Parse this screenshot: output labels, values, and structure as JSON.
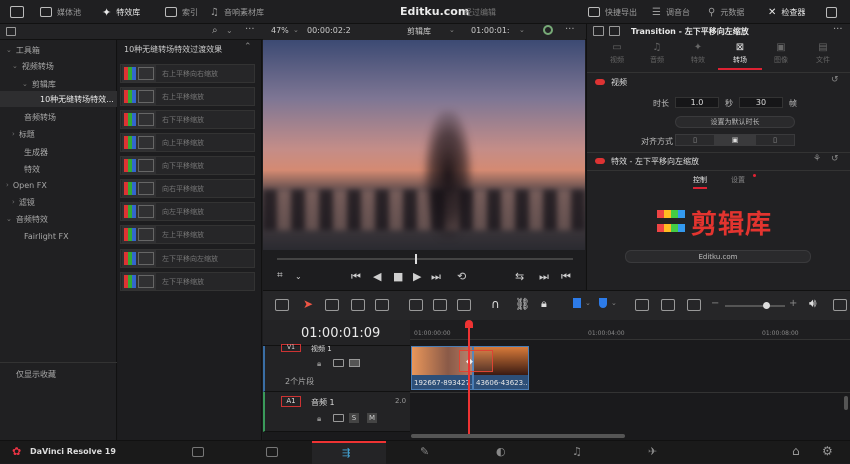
{
  "topbar": {
    "tabs": [
      {
        "label": "媒体池",
        "icon": "media-pool-icon"
      },
      {
        "label": "特效库",
        "icon": "effects-library-icon",
        "active": true
      },
      {
        "label": "索引",
        "icon": "index-icon"
      },
      {
        "label": "音响素材库",
        "icon": "sound-library-icon"
      }
    ],
    "title": "Editku.com",
    "subtitle": "经过编辑",
    "right_tabs": [
      {
        "label": "快捷导出",
        "icon": "quick-export-icon"
      },
      {
        "label": "调音台",
        "icon": "mixer-icon"
      },
      {
        "label": "元数据",
        "icon": "metadata-icon"
      },
      {
        "label": "检查器",
        "icon": "inspector-icon",
        "active": true
      }
    ]
  },
  "viewer": {
    "zoom": "47%",
    "timecode": "00:00:02:2",
    "clip_name": "剪辑库",
    "current_timecode": "01:00:01:"
  },
  "sidebar": {
    "items": [
      {
        "label": "工具箱",
        "depth": 0,
        "expanded": true
      },
      {
        "label": "视频转场",
        "depth": 1,
        "expanded": true
      },
      {
        "label": "剪辑库",
        "depth": 2,
        "expanded": true
      },
      {
        "label": "10种无缝转场特效...",
        "depth": 3,
        "selected": true
      },
      {
        "label": "音频转场",
        "depth": 1
      },
      {
        "label": "标题",
        "depth": 1,
        "collapsed": true
      },
      {
        "label": "生成器",
        "depth": 1
      },
      {
        "label": "特效",
        "depth": 1
      },
      {
        "label": "Open FX",
        "depth": 0,
        "collapsed": true
      },
      {
        "label": "滤镜",
        "depth": 1,
        "collapsed": true
      },
      {
        "label": "音频特效",
        "depth": 0,
        "expanded": true
      },
      {
        "label": "Fairlight FX",
        "depth": 1
      }
    ],
    "favorites_label": "仅显示收藏"
  },
  "fxlist": {
    "header": "10种无缝转场特效过渡效果",
    "items": [
      "右上平移向右缩放",
      "右上平移缩放",
      "右下平移缩放",
      "向上平移缩放",
      "向下平移缩放",
      "向右平移缩放",
      "向左平移缩放",
      "左上平移缩放",
      "左下平移向左缩放",
      "左下平移缩放"
    ]
  },
  "inspector": {
    "title": "Transition - 左下平移向左缩放",
    "tabs": [
      "视频",
      "音频",
      "特效",
      "转场",
      "图像",
      "文件"
    ],
    "active_tab": "转场",
    "video_section": "视频",
    "duration_label": "时长",
    "duration_value": "1.0",
    "seconds_label": "秒",
    "frames_value": "30",
    "frames_label": "帧",
    "set_default_label": "设置为默认时长",
    "alignment_label": "对齐方式",
    "effect_section": "特效 - 左下平移向左缩放",
    "subtabs": [
      "控制",
      "设置"
    ],
    "active_subtab": "控制",
    "logo_text": "剪辑库",
    "website_button": "Editku.com"
  },
  "timeline": {
    "timecode": "01:00:01:09",
    "ruler": [
      "01:00:00:00",
      "01:00:04:00",
      "01:00:08:00"
    ],
    "video_track": {
      "name": "视频 1",
      "clips_count": "2个片段"
    },
    "audio_track": {
      "id": "A1",
      "name": "音频 1",
      "level": "2.0"
    },
    "clips": [
      {
        "label": "192667-893427..."
      },
      {
        "label": "43606-43623..."
      }
    ]
  },
  "bottombar": {
    "app_name": "DaVinci Resolve 19"
  }
}
